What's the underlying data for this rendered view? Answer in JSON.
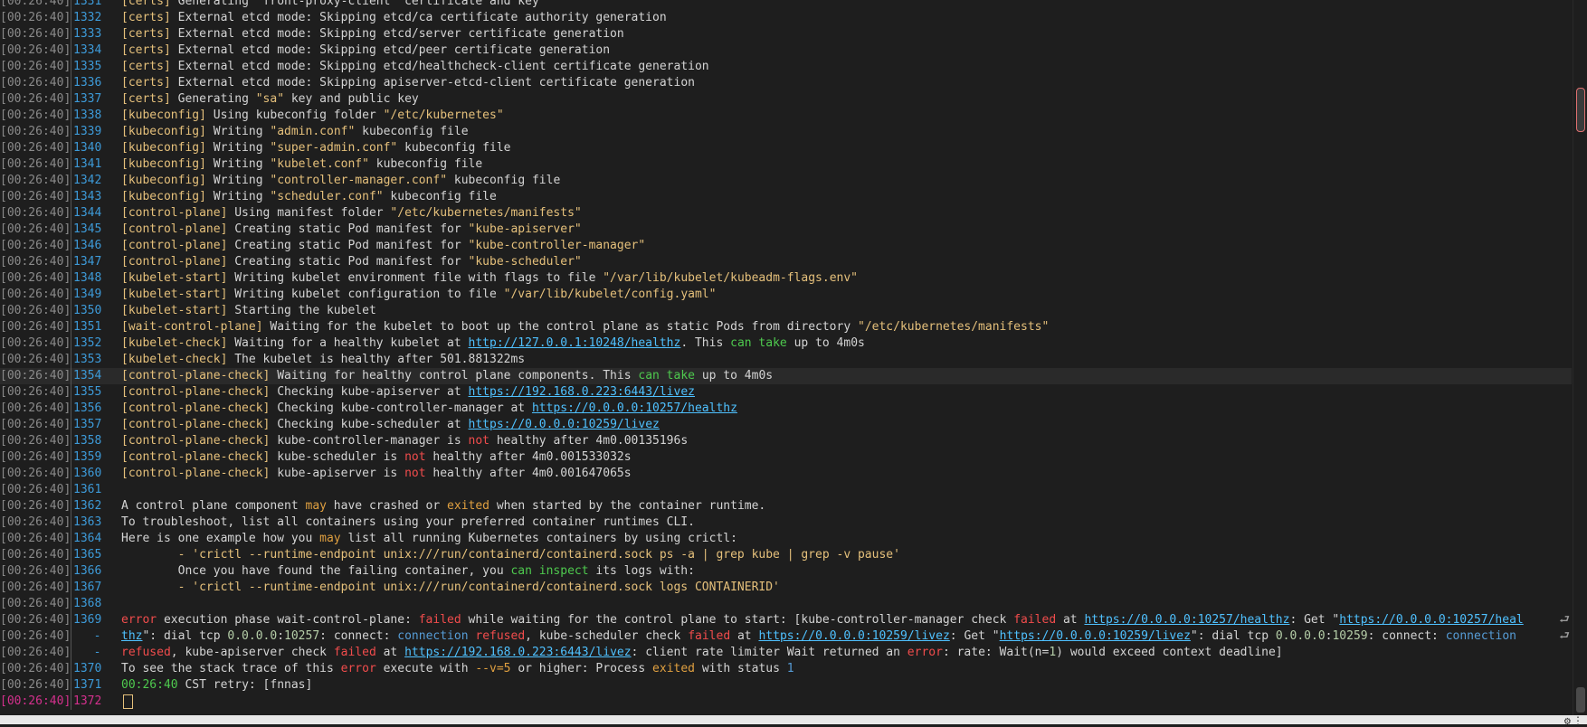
{
  "timestamp": "[00:26:40]",
  "lines": [
    {
      "n": "1331",
      "segs": [
        [
          "b",
          "[certs]"
        ],
        [
          "t",
          " Generating \"front-proxy-client\" certificate and key"
        ]
      ]
    },
    {
      "n": "1332",
      "segs": [
        [
          "b",
          "[certs]"
        ],
        [
          "t",
          " External etcd mode: Skipping etcd/ca certificate authority generation"
        ]
      ]
    },
    {
      "n": "1333",
      "segs": [
        [
          "b",
          "[certs]"
        ],
        [
          "t",
          " External etcd mode: Skipping etcd/server certificate generation"
        ]
      ]
    },
    {
      "n": "1334",
      "segs": [
        [
          "b",
          "[certs]"
        ],
        [
          "t",
          " External etcd mode: Skipping etcd/peer certificate generation"
        ]
      ]
    },
    {
      "n": "1335",
      "segs": [
        [
          "b",
          "[certs]"
        ],
        [
          "t",
          " External etcd mode: Skipping etcd/healthcheck-client certificate generation"
        ]
      ]
    },
    {
      "n": "1336",
      "segs": [
        [
          "b",
          "[certs]"
        ],
        [
          "t",
          " External etcd mode: Skipping apiserver-etcd-client certificate generation"
        ]
      ]
    },
    {
      "n": "1337",
      "segs": [
        [
          "b",
          "[certs]"
        ],
        [
          "t",
          " Generating "
        ],
        [
          "q",
          "\"sa\""
        ],
        [
          "t",
          " key and public key"
        ]
      ]
    },
    {
      "n": "1338",
      "segs": [
        [
          "b",
          "[kubeconfig]"
        ],
        [
          "t",
          " Using kubeconfig folder "
        ],
        [
          "q",
          "\"/etc/kubernetes\""
        ]
      ]
    },
    {
      "n": "1339",
      "segs": [
        [
          "b",
          "[kubeconfig]"
        ],
        [
          "t",
          " Writing "
        ],
        [
          "q",
          "\"admin.conf\""
        ],
        [
          "t",
          " kubeconfig file"
        ]
      ]
    },
    {
      "n": "1340",
      "segs": [
        [
          "b",
          "[kubeconfig]"
        ],
        [
          "t",
          " Writing "
        ],
        [
          "q",
          "\"super-admin.conf\""
        ],
        [
          "t",
          " kubeconfig file"
        ]
      ]
    },
    {
      "n": "1341",
      "segs": [
        [
          "b",
          "[kubeconfig]"
        ],
        [
          "t",
          " Writing "
        ],
        [
          "q",
          "\"kubelet.conf\""
        ],
        [
          "t",
          " kubeconfig file"
        ]
      ]
    },
    {
      "n": "1342",
      "segs": [
        [
          "b",
          "[kubeconfig]"
        ],
        [
          "t",
          " Writing "
        ],
        [
          "q",
          "\"controller-manager.conf\""
        ],
        [
          "t",
          " kubeconfig file"
        ]
      ]
    },
    {
      "n": "1343",
      "segs": [
        [
          "b",
          "[kubeconfig]"
        ],
        [
          "t",
          " Writing "
        ],
        [
          "q",
          "\"scheduler.conf\""
        ],
        [
          "t",
          " kubeconfig file"
        ]
      ]
    },
    {
      "n": "1344",
      "segs": [
        [
          "b",
          "[control-plane]"
        ],
        [
          "t",
          " Using manifest folder "
        ],
        [
          "q",
          "\"/etc/kubernetes/manifests\""
        ]
      ]
    },
    {
      "n": "1345",
      "segs": [
        [
          "b",
          "[control-plane]"
        ],
        [
          "t",
          " Creating static Pod manifest for "
        ],
        [
          "q",
          "\"kube-apiserver\""
        ]
      ]
    },
    {
      "n": "1346",
      "segs": [
        [
          "b",
          "[control-plane]"
        ],
        [
          "t",
          " Creating static Pod manifest for "
        ],
        [
          "q",
          "\"kube-controller-manager\""
        ]
      ]
    },
    {
      "n": "1347",
      "segs": [
        [
          "b",
          "[control-plane]"
        ],
        [
          "t",
          " Creating static Pod manifest for "
        ],
        [
          "q",
          "\"kube-scheduler\""
        ]
      ]
    },
    {
      "n": "1348",
      "segs": [
        [
          "b",
          "[kubelet-start]"
        ],
        [
          "t",
          " Writing kubelet environment file with flags to file "
        ],
        [
          "q",
          "\"/var/lib/kubelet/kubeadm-flags.env\""
        ]
      ]
    },
    {
      "n": "1349",
      "segs": [
        [
          "b",
          "[kubelet-start]"
        ],
        [
          "t",
          " Writing kubelet configuration to file "
        ],
        [
          "q",
          "\"/var/lib/kubelet/config.yaml\""
        ]
      ]
    },
    {
      "n": "1350",
      "segs": [
        [
          "b",
          "[kubelet-start]"
        ],
        [
          "t",
          " Starting the kubelet"
        ]
      ]
    },
    {
      "n": "1351",
      "segs": [
        [
          "b",
          "[wait-control-plane]"
        ],
        [
          "t",
          " Waiting for the kubelet to boot up the control plane as static Pods from directory "
        ],
        [
          "q",
          "\"/etc/kubernetes/manifests\""
        ]
      ]
    },
    {
      "n": "1352",
      "segs": [
        [
          "b",
          "[kubelet-check]"
        ],
        [
          "t",
          " Waiting for a healthy kubelet at "
        ],
        [
          "u",
          "http://127.0.0.1:10248/healthz"
        ],
        [
          "t",
          ". This "
        ],
        [
          "g",
          "can take"
        ],
        [
          "t",
          " up to 4m0s"
        ]
      ]
    },
    {
      "n": "1353",
      "segs": [
        [
          "b",
          "[kubelet-check]"
        ],
        [
          "t",
          " The kubelet is healthy after 501.881322ms"
        ]
      ]
    },
    {
      "n": "1354",
      "hl": true,
      "segs": [
        [
          "b",
          "[control-plane-check]"
        ],
        [
          "t",
          " Waiting for healthy control plane components. This "
        ],
        [
          "g",
          "can take"
        ],
        [
          "t",
          " up to 4m0s"
        ]
      ]
    },
    {
      "n": "1355",
      "segs": [
        [
          "b",
          "[control-plane-check]"
        ],
        [
          "t",
          " Checking kube-apiserver at "
        ],
        [
          "u",
          "https://192.168.0.223:6443/livez"
        ]
      ]
    },
    {
      "n": "1356",
      "segs": [
        [
          "b",
          "[control-plane-check]"
        ],
        [
          "t",
          " Checking kube-controller-manager at "
        ],
        [
          "u",
          "https://0.0.0.0:10257/healthz"
        ]
      ]
    },
    {
      "n": "1357",
      "segs": [
        [
          "b",
          "[control-plane-check]"
        ],
        [
          "t",
          " Checking kube-scheduler at "
        ],
        [
          "u",
          "https://0.0.0.0:10259/livez"
        ]
      ]
    },
    {
      "n": "1358",
      "segs": [
        [
          "b",
          "[control-plane-check]"
        ],
        [
          "t",
          " kube-controller-manager is "
        ],
        [
          "r",
          "not"
        ],
        [
          "t",
          " healthy after 4m0.00135196s"
        ]
      ]
    },
    {
      "n": "1359",
      "segs": [
        [
          "b",
          "[control-plane-check]"
        ],
        [
          "t",
          " kube-scheduler is "
        ],
        [
          "r",
          "not"
        ],
        [
          "t",
          " healthy after 4m0.001533032s"
        ]
      ]
    },
    {
      "n": "1360",
      "segs": [
        [
          "b",
          "[control-plane-check]"
        ],
        [
          "t",
          " kube-apiserver is "
        ],
        [
          "r",
          "not"
        ],
        [
          "t",
          " healthy after 4m0.001647065s"
        ]
      ]
    },
    {
      "n": "1361",
      "segs": []
    },
    {
      "n": "1362",
      "segs": [
        [
          "t",
          "A control plane component "
        ],
        [
          "o",
          "may"
        ],
        [
          "t",
          " have crashed or "
        ],
        [
          "o",
          "exited"
        ],
        [
          "t",
          " when started by the container runtime."
        ]
      ]
    },
    {
      "n": "1363",
      "segs": [
        [
          "t",
          "To troubleshoot, list all containers using your preferred container runtimes CLI."
        ]
      ]
    },
    {
      "n": "1364",
      "segs": [
        [
          "t",
          "Here is one example how you "
        ],
        [
          "o",
          "may"
        ],
        [
          "t",
          " list all running Kubernetes containers by using crictl:"
        ]
      ]
    },
    {
      "n": "1365",
      "segs": [
        [
          "q",
          "        - 'crictl --runtime-endpoint unix:///run/containerd/containerd.sock ps -a | grep kube | grep -v pause'"
        ]
      ]
    },
    {
      "n": "1366",
      "segs": [
        [
          "t",
          "        Once you have found the failing container, you "
        ],
        [
          "g",
          "can inspect"
        ],
        [
          "t",
          " its logs with:"
        ]
      ]
    },
    {
      "n": "1367",
      "segs": [
        [
          "q",
          "        - 'crictl --runtime-endpoint unix:///run/containerd/containerd.sock logs CONTAINERID'"
        ]
      ]
    },
    {
      "n": "1368",
      "segs": []
    },
    {
      "n": "1369",
      "wrap": true,
      "segs": [
        [
          "r",
          "error"
        ],
        [
          "t",
          " execution phase wait-control-plane: "
        ],
        [
          "r",
          "failed"
        ],
        [
          "t",
          " while waiting for the control plane to start: [kube-controller-manager check "
        ],
        [
          "r",
          "failed"
        ],
        [
          "t",
          " at "
        ],
        [
          "u",
          "https://0.0.0.0:10257/healthz"
        ],
        [
          "t",
          ": Get \""
        ],
        [
          "u",
          "https://0.0.0.0:10257/heal"
        ]
      ]
    },
    {
      "n": "-",
      "cont": true,
      "wrap": true,
      "segs": [
        [
          "u",
          "thz"
        ],
        [
          "t",
          "\": dial tcp "
        ],
        [
          "n",
          "0.0.0.0"
        ],
        [
          "t",
          ":"
        ],
        [
          "n",
          "10257"
        ],
        [
          "t",
          ": connect: "
        ],
        [
          "bl",
          "connection"
        ],
        [
          "t",
          " "
        ],
        [
          "r",
          "refused"
        ],
        [
          "t",
          ", kube-scheduler check "
        ],
        [
          "r",
          "failed"
        ],
        [
          "t",
          " at "
        ],
        [
          "u",
          "https://0.0.0.0:10259/livez"
        ],
        [
          "t",
          ": Get \""
        ],
        [
          "u",
          "https://0.0.0.0:10259/livez"
        ],
        [
          "t",
          "\": dial tcp "
        ],
        [
          "n",
          "0.0.0.0"
        ],
        [
          "t",
          ":"
        ],
        [
          "n",
          "10259"
        ],
        [
          "t",
          ": connect: "
        ],
        [
          "bl",
          "connection"
        ]
      ]
    },
    {
      "n": "-",
      "cont": true,
      "segs": [
        [
          "r",
          "refused"
        ],
        [
          "t",
          ", kube-apiserver check "
        ],
        [
          "r",
          "failed"
        ],
        [
          "t",
          " at "
        ],
        [
          "u",
          "https://192.168.0.223:6443/livez"
        ],
        [
          "t",
          ": client rate limiter Wait returned an "
        ],
        [
          "r",
          "error"
        ],
        [
          "t",
          ": rate: Wait(n="
        ],
        [
          "n",
          "1"
        ],
        [
          "t",
          ") would exceed context deadline]"
        ]
      ]
    },
    {
      "n": "1370",
      "segs": [
        [
          "t",
          "To see the stack trace of this "
        ],
        [
          "r",
          "error"
        ],
        [
          "t",
          " execute with "
        ],
        [
          "o",
          "--v=5"
        ],
        [
          "t",
          " or higher: Process "
        ],
        [
          "o",
          "exited"
        ],
        [
          "t",
          " with status "
        ],
        [
          "bl",
          "1"
        ]
      ]
    },
    {
      "n": "1371",
      "segs": [
        [
          "g",
          "00:26:40"
        ],
        [
          "t",
          " CST retry: [fnnas]"
        ]
      ]
    },
    {
      "n": "1372",
      "cur": true,
      "segs": []
    }
  ],
  "wrap_glyph": "⮐",
  "icons": {
    "gear": "gear-icon",
    "more": "more-icon"
  },
  "colors": {
    "bg": "#1e1e1e",
    "bracket": "#e5c07b",
    "url": "#4fc1ff",
    "error": "#f14c4c",
    "ok": "#4ec94e"
  }
}
